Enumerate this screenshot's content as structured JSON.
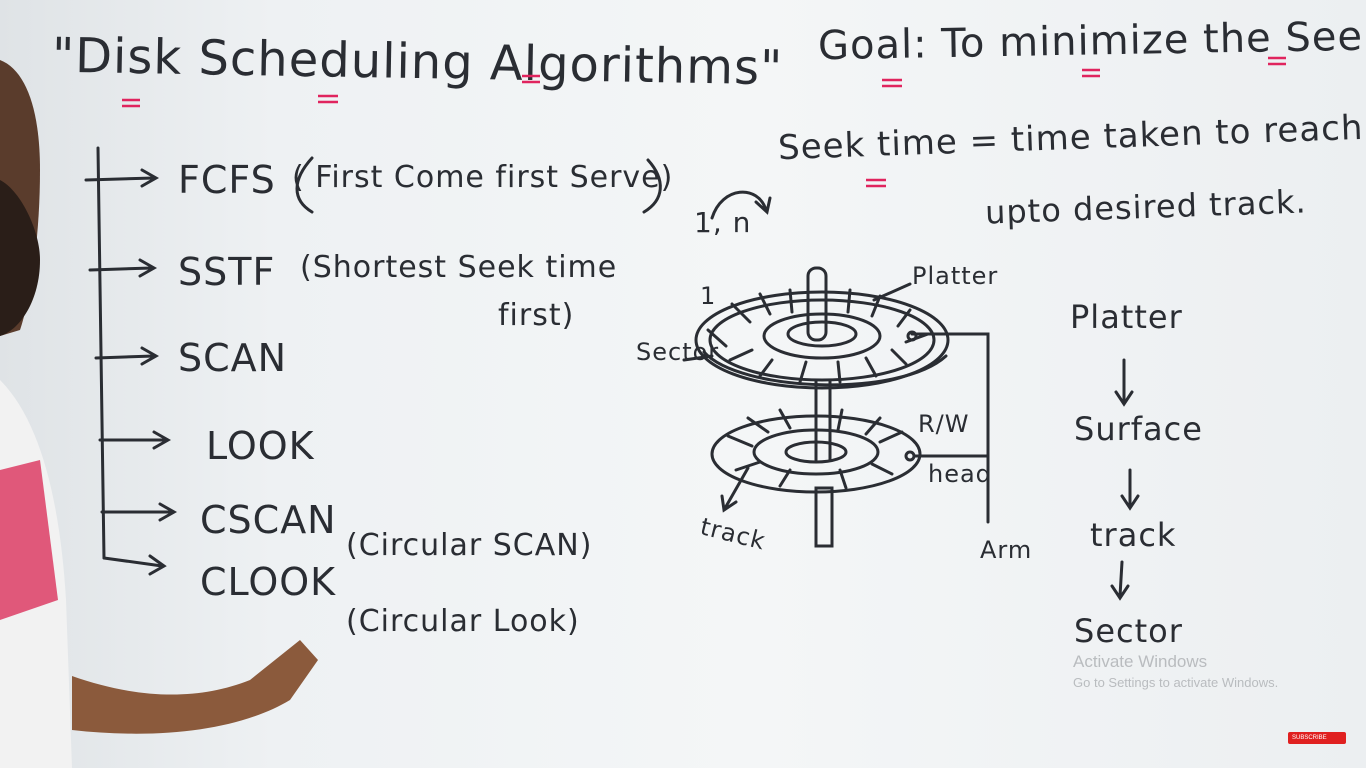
{
  "board": {
    "title": "\"Disk Scheduling Algorithms\"",
    "goal": "Goal: To minimize the Seek t",
    "seek_time_line1": "Seek time = time taken to reach",
    "seek_time_line2": "upto desired track."
  },
  "algorithms": [
    {
      "name": "FCFS",
      "description": "( First Come first Serve)"
    },
    {
      "name": "SSTF",
      "description": "(Shortest Seek time",
      "description_2": "first)"
    },
    {
      "name": "SCAN",
      "description": ""
    },
    {
      "name": "LOOK",
      "description": ""
    },
    {
      "name": "CSCAN",
      "description": "(Circular SCAN)"
    },
    {
      "name": "CLOOK",
      "description": "(Circular Look)"
    }
  ],
  "diagram": {
    "platter": "Platter",
    "sector": "Sector",
    "rw": "R/W",
    "head": "head",
    "track": "track",
    "arm": "Arm",
    "one": "1",
    "one_to_n": "1,   n"
  },
  "hierarchy": [
    "Platter",
    "Surface",
    "track",
    "Sector"
  ],
  "watermark": {
    "line1": "Activate Windows",
    "line2": "Go to Settings to activate Windows."
  },
  "subscribe_badge": "SUBSCRIBE",
  "colors": {
    "marker": "#2a2d33",
    "underline": "#e0245e",
    "board": "#eef1f3",
    "badge": "#e02020"
  }
}
